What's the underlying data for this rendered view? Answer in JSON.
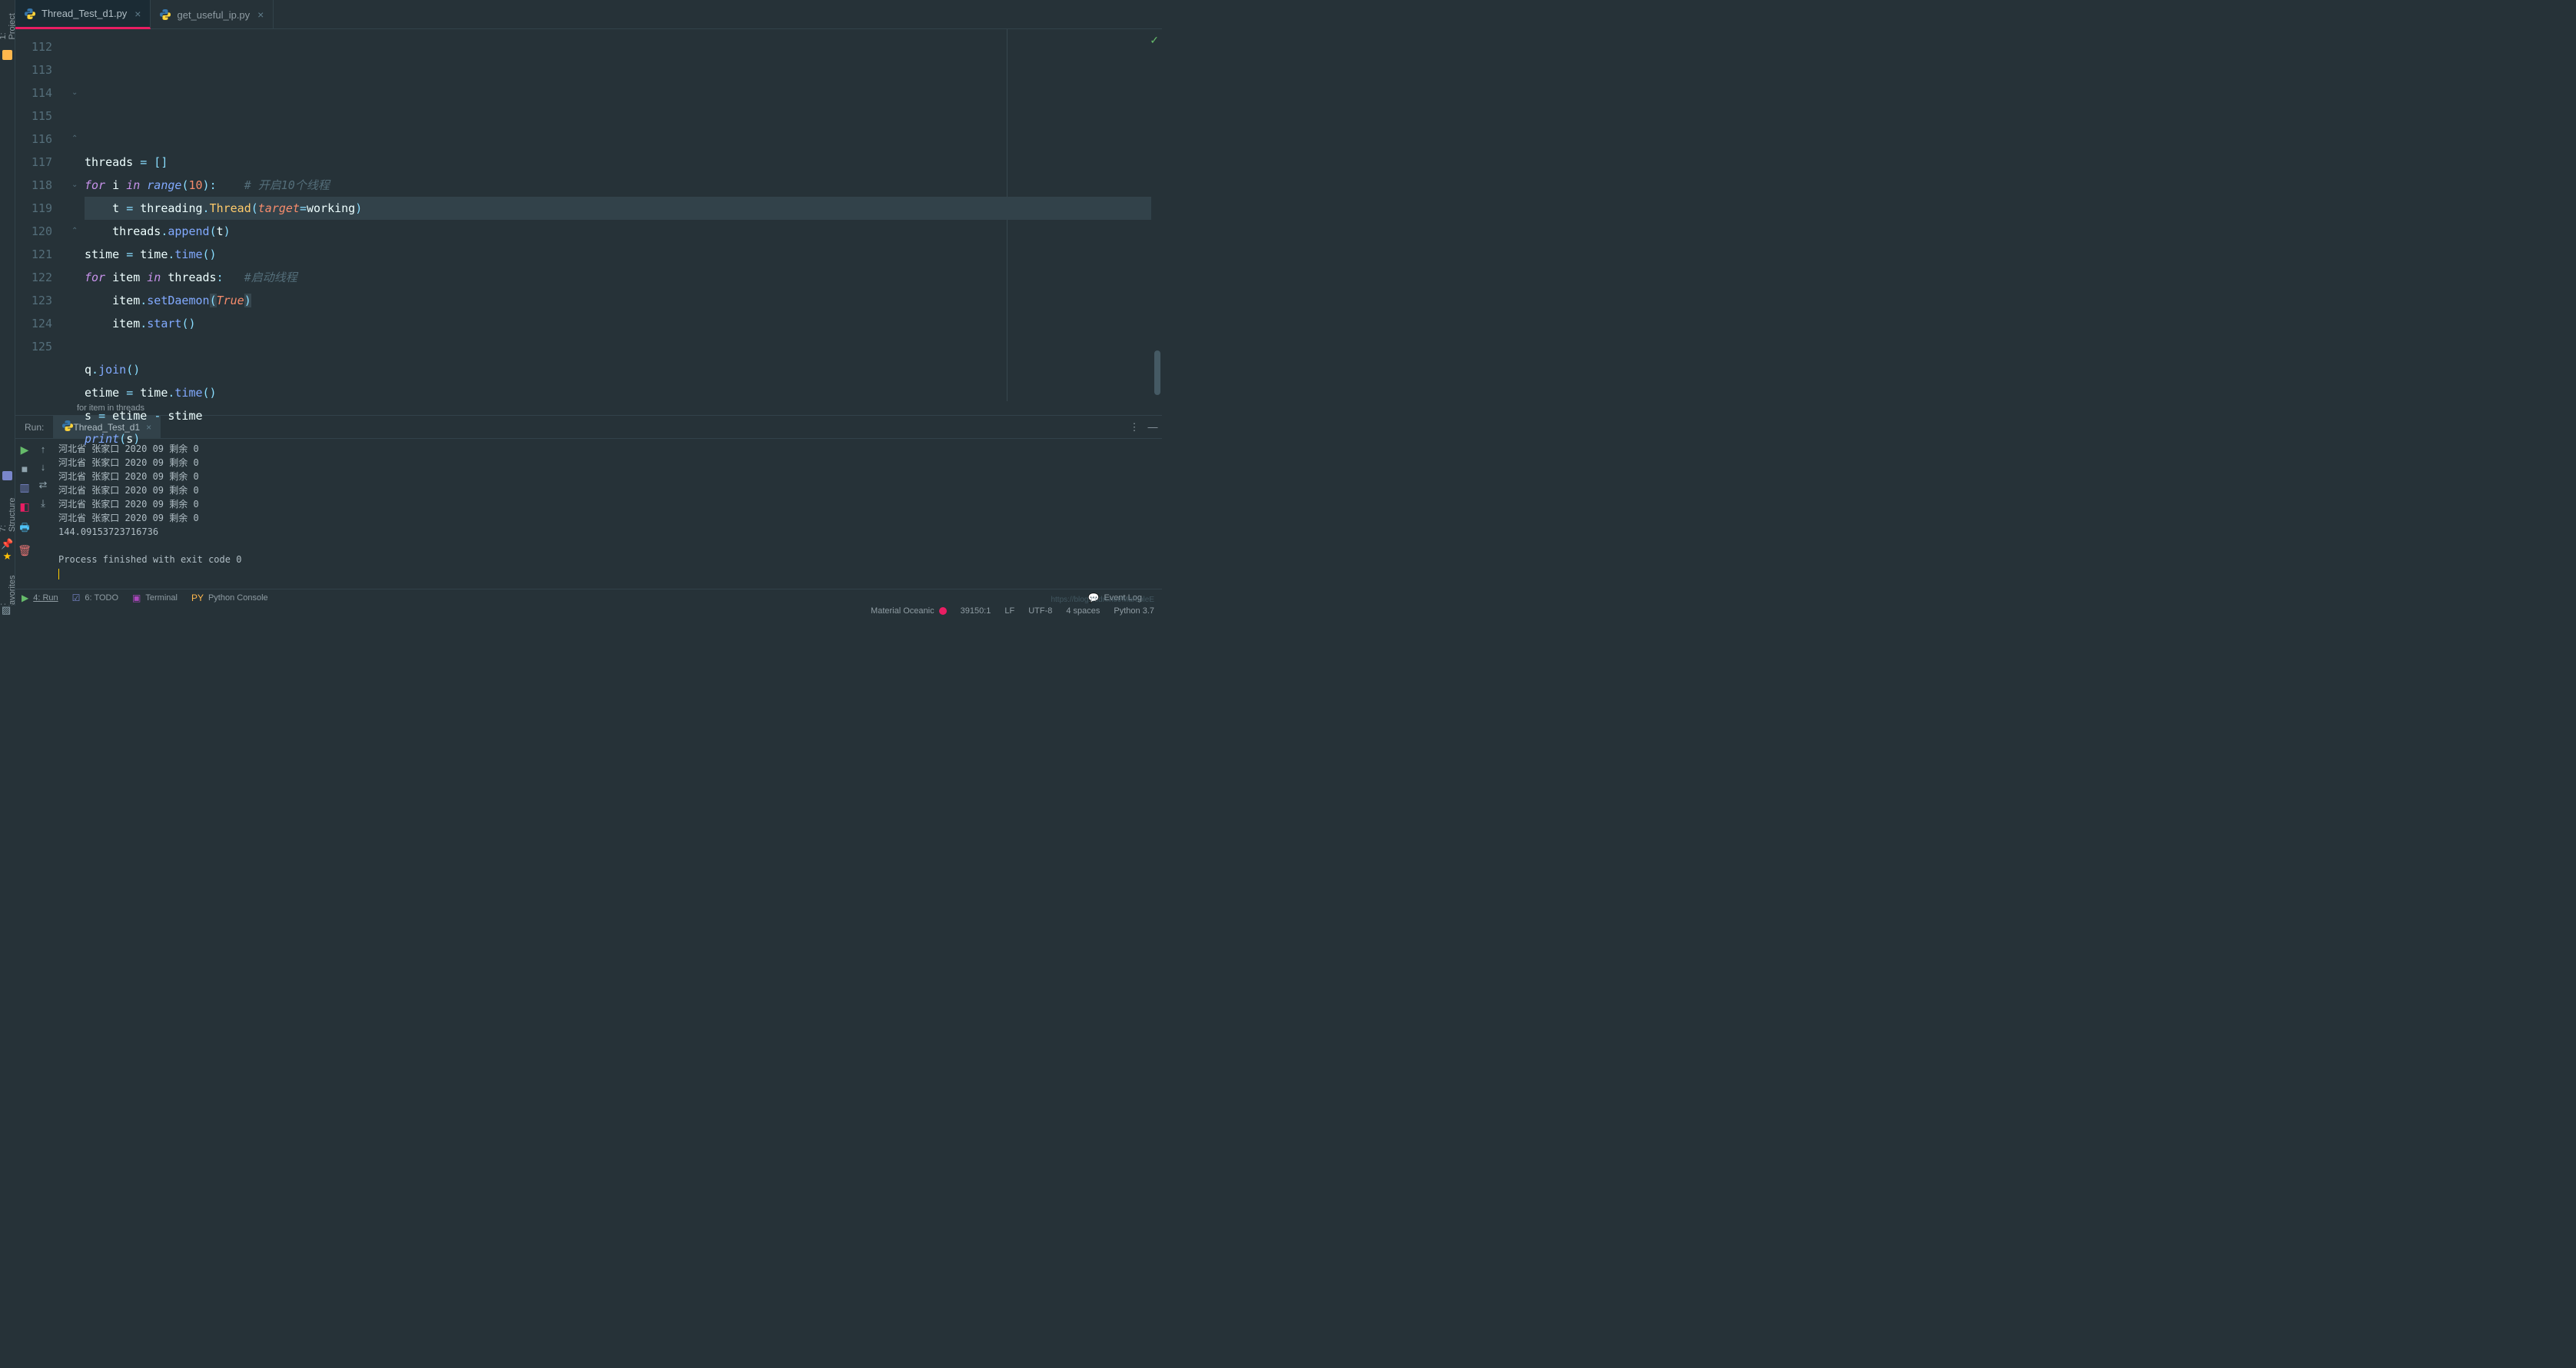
{
  "tabs": [
    {
      "name": "Thread_Test_d1.py",
      "active": true
    },
    {
      "name": "get_useful_ip.py",
      "active": false
    }
  ],
  "gutter_start": 112,
  "gutter_end": 125,
  "highlighted_line": 119,
  "code_tokens": [
    [],
    [
      [
        "id",
        "threads "
      ],
      [
        "op",
        "= []"
      ]
    ],
    [
      [
        "kw",
        "for "
      ],
      [
        "id",
        "i "
      ],
      [
        "kw",
        "in "
      ],
      [
        "builtin",
        "range"
      ],
      [
        "op",
        "("
      ],
      [
        "num",
        "10"
      ],
      [
        "op",
        ")"
      ],
      [
        "op",
        ":"
      ],
      [
        "id",
        "    "
      ],
      [
        "cmt",
        "# 开启10个线程"
      ]
    ],
    [
      [
        "id",
        "    t "
      ],
      [
        "op",
        "= "
      ],
      [
        "id",
        "threading"
      ],
      [
        "op",
        "."
      ],
      [
        "cls",
        "Thread"
      ],
      [
        "op",
        "("
      ],
      [
        "param",
        "target"
      ],
      [
        "op",
        "="
      ],
      [
        "id",
        "working"
      ],
      [
        "op",
        ")"
      ]
    ],
    [
      [
        "id",
        "    threads"
      ],
      [
        "op",
        "."
      ],
      [
        "fn",
        "append"
      ],
      [
        "op",
        "("
      ],
      [
        "id",
        "t"
      ],
      [
        "op",
        ")"
      ]
    ],
    [
      [
        "id",
        "stime "
      ],
      [
        "op",
        "= "
      ],
      [
        "id",
        "time"
      ],
      [
        "op",
        "."
      ],
      [
        "fn",
        "time"
      ],
      [
        "op",
        "()"
      ]
    ],
    [
      [
        "kw",
        "for "
      ],
      [
        "id",
        "item "
      ],
      [
        "kw",
        "in "
      ],
      [
        "id",
        "threads"
      ],
      [
        "op",
        ":"
      ],
      [
        "id",
        "   "
      ],
      [
        "cmt",
        "#启动线程"
      ]
    ],
    [
      [
        "id",
        "    item"
      ],
      [
        "op",
        "."
      ],
      [
        "fn",
        "setDaemon"
      ],
      [
        "op match-br",
        "("
      ],
      [
        "str-bool",
        "True"
      ],
      [
        "op match-br",
        ")"
      ]
    ],
    [
      [
        "id",
        "    item"
      ],
      [
        "op",
        "."
      ],
      [
        "fn",
        "start"
      ],
      [
        "op",
        "()"
      ]
    ],
    [],
    [
      [
        "id",
        "q"
      ],
      [
        "op",
        "."
      ],
      [
        "fn",
        "join"
      ],
      [
        "op",
        "()"
      ]
    ],
    [
      [
        "id",
        "etime "
      ],
      [
        "op",
        "= "
      ],
      [
        "id",
        "time"
      ],
      [
        "op",
        "."
      ],
      [
        "fn",
        "time"
      ],
      [
        "op",
        "()"
      ]
    ],
    [
      [
        "id",
        "s "
      ],
      [
        "op",
        "= "
      ],
      [
        "id",
        "etime "
      ],
      [
        "op",
        "- "
      ],
      [
        "id",
        "stime"
      ]
    ],
    [
      [
        "builtin",
        "print"
      ],
      [
        "op",
        "("
      ],
      [
        "id",
        "s"
      ],
      [
        "op",
        ")"
      ]
    ]
  ],
  "breadcrumb": "for item in threads",
  "run": {
    "label": "Run:",
    "tab": "Thread_Test_d1",
    "output": [
      "河北省 张家口 2020 09 剩余 0",
      "河北省 张家口 2020 09 剩余 0",
      "河北省 张家口 2020 09 剩余 0",
      "河北省 张家口 2020 09 剩余 0",
      "河北省 张家口 2020 09 剩余 0",
      "河北省 张家口 2020 09 剩余 0",
      "144.09153723716736",
      "",
      "Process finished with exit code 0"
    ]
  },
  "left_tools": {
    "project": "1: Project",
    "structure": "7: Structure",
    "favorites": "2: Favorites"
  },
  "bottom_tools": {
    "run": "4: Run",
    "todo": "6: TODO",
    "terminal": "Terminal",
    "pyconsole": "Python Console",
    "eventlog": "Event Log"
  },
  "status": {
    "theme": "Material Oceanic",
    "pos": "39150:1",
    "le": "LF",
    "enc": "UTF-8",
    "indent": "4 spaces",
    "python": "Python 3.7"
  },
  "watermark": "https://blog.csdn.net/MarcoleE"
}
